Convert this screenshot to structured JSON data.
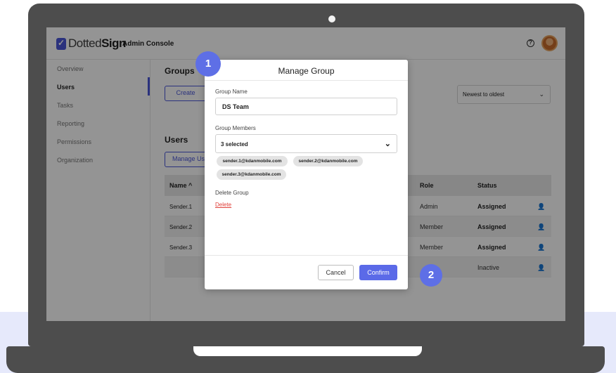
{
  "colors": {
    "accent": "#4a56d8",
    "confirm": "#5b6ae8",
    "badge": "#5e6fe6",
    "delete": "#e0403a",
    "laptop": "#4d4d4d"
  },
  "app": {
    "logo_prefix": "Dotted",
    "logo_suffix": "Sign",
    "console_label": "Admin Console",
    "help_icon": "question-circle-icon"
  },
  "sidebar": {
    "items": [
      {
        "label": "Overview"
      },
      {
        "label": "Users"
      },
      {
        "label": "Tasks"
      },
      {
        "label": "Reporting"
      },
      {
        "label": "Permissions"
      },
      {
        "label": "Organization"
      }
    ],
    "active_index": 1
  },
  "main": {
    "groups_title": "Groups",
    "create_label": "Create",
    "sort_value": "Newest to oldest",
    "users_title": "Users",
    "manage_users_label": "Manage Users",
    "table": {
      "headers": {
        "name": "Name ^",
        "role": "Role",
        "status": "Status"
      },
      "rows": [
        {
          "name": "Sender.1",
          "role": "Admin",
          "status": "Assigned"
        },
        {
          "name": "Sender.2",
          "role": "Member",
          "status": "Assigned"
        },
        {
          "name": "Sender.3",
          "role": "Member",
          "status": "Assigned"
        },
        {
          "name": "",
          "role": "",
          "status": "Inactive"
        }
      ]
    }
  },
  "modal": {
    "title": "Manage Group",
    "group_name_label": "Group Name",
    "group_name_value": "DS Team",
    "group_members_label": "Group Members",
    "members_selected": "3 selected",
    "member_chips": [
      "sender.1@kdanmobile.com",
      "sender.2@kdanmobile.com",
      "sender.3@kdanmobile.com"
    ],
    "delete_group_label": "Delete Group",
    "delete_link": "Delete",
    "cancel_label": "Cancel",
    "confirm_label": "Confirm"
  },
  "callouts": {
    "step_one": "1",
    "step_two": "2"
  }
}
